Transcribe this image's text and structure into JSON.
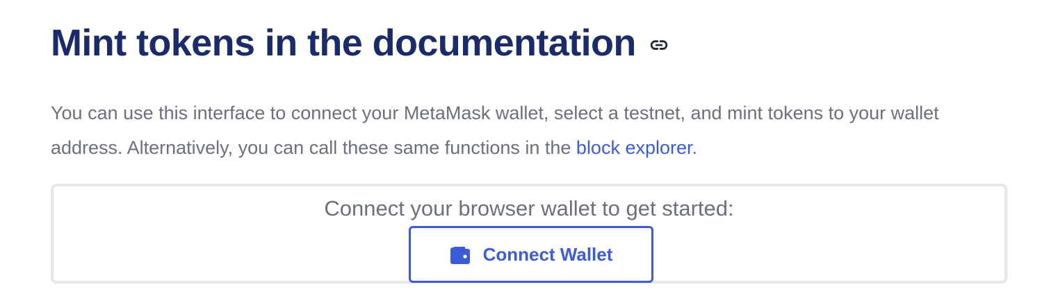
{
  "heading": {
    "title": "Mint tokens in the documentation",
    "anchor_icon": "link-icon"
  },
  "intro": {
    "text_before_link": "You can use this interface to connect your MetaMask wallet, select a testnet, and mint tokens to your wallet address. Alternatively, you can call these same functions in the ",
    "link_text": "block explorer",
    "text_after_link": "."
  },
  "mint_card": {
    "prompt": "Connect your browser wallet to get started:",
    "connect_button": {
      "label": "Connect Wallet",
      "icon": "wallet-icon"
    }
  },
  "colors": {
    "heading": "#1a2b6b",
    "body_text": "#6b6f7e",
    "accent": "#3b5bdb",
    "card_border": "#e6e7ea"
  }
}
